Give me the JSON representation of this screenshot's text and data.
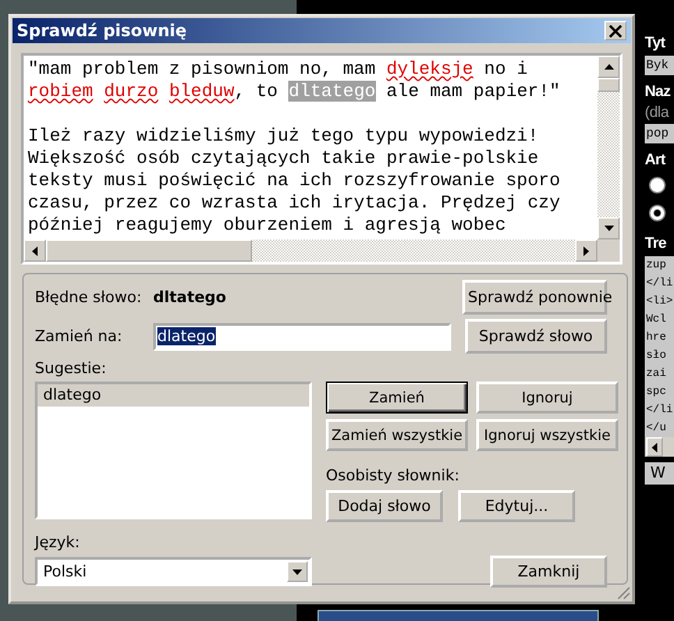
{
  "window": {
    "title": "Sprawdź pisownię"
  },
  "document": {
    "paragraphs": [
      {
        "lines": [
          [
            {
              "kind": "normal",
              "text": "\"mam problem z pisowniom no, mam "
            },
            {
              "kind": "error",
              "text": "dyleksje"
            },
            {
              "kind": "normal",
              "text": " no i"
            }
          ],
          [
            {
              "kind": "error",
              "text": "robiem "
            },
            {
              "kind": "error",
              "text": "durzo "
            },
            {
              "kind": "error",
              "text": "bleduw"
            },
            {
              "kind": "normal",
              "text": ", to "
            },
            {
              "kind": "current",
              "text": "dltatego"
            },
            {
              "kind": "normal",
              "text": " ale mam papier!\""
            }
          ]
        ]
      },
      {
        "lines": [
          [
            {
              "kind": "normal",
              "text": "Ileż razy widzieliśmy już tego typu wypowiedzi!"
            }
          ],
          [
            {
              "kind": "normal",
              "text": "Większość osób czytających takie prawie-polskie"
            }
          ],
          [
            {
              "kind": "normal",
              "text": "teksty musi poświęcić na ich rozszyfrowanie sporo"
            }
          ],
          [
            {
              "kind": "normal",
              "text": "czasu, przez co wzrasta ich irytacja. Prędzej czy"
            }
          ],
          [
            {
              "kind": "normal",
              "text": "później reagujemy oburzeniem i agresją wobec"
            }
          ]
        ]
      }
    ]
  },
  "misspelled": {
    "label": "Błędne słowo:",
    "word": "dltatego"
  },
  "replace_with": {
    "label": "Zamień na:",
    "value": "dlatego",
    "text_selected": true
  },
  "suggestions": {
    "label": "Sugestie:",
    "items": [
      {
        "text": "dlatego",
        "selected": true
      }
    ]
  },
  "recheck_button": "Sprawdź ponownie",
  "check_word_button": "Sprawdź słowo",
  "action_buttons": [
    {
      "text": "Zamień",
      "default": true
    },
    {
      "text": "Ignoruj",
      "default": false
    },
    {
      "text": "Zamień wszystkie",
      "default": false
    },
    {
      "text": "Ignoruj wszystkie",
      "default": false
    }
  ],
  "personal_dictionary": {
    "label": "Osobisty słownik:",
    "buttons": [
      "Dodaj słowo",
      "Edytuj..."
    ]
  },
  "language": {
    "label": "Język:",
    "value": "Polski"
  },
  "close_button": "Zamknij",
  "side_form": [
    {
      "kind": "label",
      "text": "Tyt"
    },
    {
      "kind": "input",
      "text": "Byk"
    },
    {
      "kind": "label",
      "text": "Naz"
    },
    {
      "kind": "hint",
      "text": "(dla"
    },
    {
      "kind": "input",
      "text": "pop"
    },
    {
      "kind": "label",
      "text": "Art"
    },
    {
      "kind": "radio",
      "selected": false
    },
    {
      "kind": "radio",
      "selected": true
    },
    {
      "kind": "label",
      "text": "Tre"
    },
    {
      "kind": "textarea",
      "lines": [
        "zup",
        "</li",
        "<li>",
        "Wcl",
        "hre",
        "sło",
        "zai",
        "spc",
        "</li",
        "</u"
      ]
    },
    {
      "kind": "button",
      "text": "W"
    }
  ]
}
